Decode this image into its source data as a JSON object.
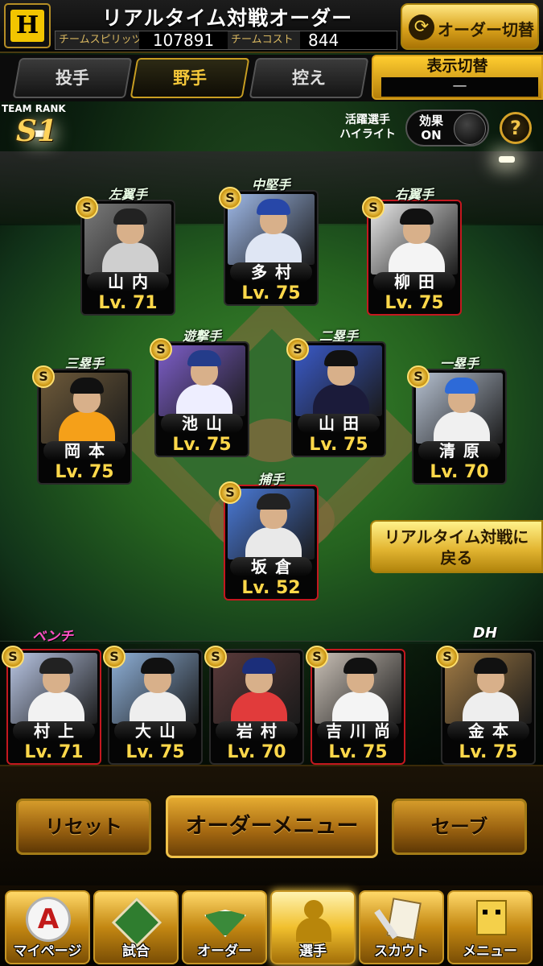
{
  "header": {
    "team_logo_text": "H",
    "title": "リアルタイム対戦オーダー",
    "team_spirits_label": "チームスピリッツ",
    "team_spirits_value": "107891",
    "team_cost_label": "チームコスト",
    "team_cost_value": "844",
    "switch_order_label": "オーダー切替"
  },
  "tabs": [
    {
      "label": "投手",
      "active": false
    },
    {
      "label": "野手",
      "active": true
    },
    {
      "label": "控え",
      "active": false
    }
  ],
  "display_toggle": {
    "label": "表示切替",
    "value": "—"
  },
  "team_rank": {
    "label": "TEAM RANK",
    "value": "S1"
  },
  "highlight": {
    "label_line1": "活躍選手",
    "label_line2": "ハイライト",
    "effect_label_1": "効果",
    "effect_label_2": "ON"
  },
  "help_label": "?",
  "positions": [
    {
      "id": "lf",
      "position": "左翼手",
      "name": "山内",
      "level": "Lv. 71",
      "badge": "S",
      "photo": "#7a7a7a",
      "cap": "#222",
      "body": "#cfcfcf",
      "border": "default"
    },
    {
      "id": "cf",
      "position": "中堅手",
      "name": "多村",
      "level": "Lv. 75",
      "badge": "S",
      "photo": "#9fb9e8",
      "cap": "#2747a8",
      "body": "#dfe6f4",
      "border": "default"
    },
    {
      "id": "rf",
      "position": "右翼手",
      "name": "柳田",
      "level": "Lv. 75",
      "badge": "S",
      "photo": "#e8e8e8",
      "cap": "#111",
      "body": "#f4f4f4",
      "border": "red"
    },
    {
      "id": "ss",
      "position": "遊撃手",
      "name": "池山",
      "level": "Lv. 75",
      "badge": "S",
      "photo": "#7d5ec9",
      "cap": "#243c8a",
      "body": "#eeeeff",
      "border": "default"
    },
    {
      "id": "2b",
      "position": "二塁手",
      "name": "山田",
      "level": "Lv. 75",
      "badge": "S",
      "photo": "#3a5ac8",
      "cap": "#111",
      "body": "#1b1b3a",
      "border": "default"
    },
    {
      "id": "3b",
      "position": "三塁手",
      "name": "岡本",
      "level": "Lv. 75",
      "badge": "S",
      "photo": "#6e5a3a",
      "cap": "#111",
      "body": "#f5a019",
      "border": "default"
    },
    {
      "id": "1b",
      "position": "一塁手",
      "name": "清原",
      "level": "Lv. 70",
      "badge": "S",
      "photo": "#b5c0d0",
      "cap": "#2d6ad8",
      "body": "#f0f0f0",
      "border": "default"
    },
    {
      "id": "c",
      "position": "捕手",
      "name": "坂倉",
      "level": "Lv. 52",
      "badge": "S",
      "photo": "#4a7ad8",
      "cap": "#222",
      "body": "#e9e9e9",
      "border": "red"
    }
  ],
  "bench": {
    "label": "ベンチ",
    "dh_label": "DH",
    "players": [
      {
        "name": "村上",
        "level": "Lv. 71",
        "badge": "S",
        "photo": "#b9c6e4",
        "cap": "#222",
        "body": "#f2f2f2",
        "border": "red"
      },
      {
        "name": "大山",
        "level": "Lv. 75",
        "badge": "S",
        "photo": "#8eb0d8",
        "cap": "#111",
        "body": "#eeeeee",
        "border": "default"
      },
      {
        "name": "岩村",
        "level": "Lv. 70",
        "badge": "S",
        "photo": "#5a3a3a",
        "cap": "#1b2e7a",
        "body": "#e13b3b",
        "border": "default"
      },
      {
        "name": "吉川尚",
        "level": "Lv. 75",
        "badge": "S",
        "photo": "#c9c0b6",
        "cap": "#111",
        "body": "#f4f4f4",
        "border": "red"
      },
      {
        "name": "金本",
        "level": "Lv. 75",
        "badge": "S",
        "photo": "#a07a44",
        "cap": "#111",
        "body": "#eee",
        "border": "default"
      }
    ]
  },
  "return_button": {
    "line1": "リアルタイム対戦に",
    "line2": "戻る"
  },
  "actions": {
    "reset": "リセット",
    "order_menu": "オーダーメニュー",
    "save": "セーブ"
  },
  "footer_nav": [
    {
      "label": "マイページ",
      "icon": "a-icon",
      "active": false
    },
    {
      "label": "試合",
      "icon": "baseball-field-icon",
      "active": false
    },
    {
      "label": "オーダー",
      "icon": "order-field-icon",
      "active": false
    },
    {
      "label": "選手",
      "icon": "player-icon",
      "active": true
    },
    {
      "label": "スカウト",
      "icon": "scout-icon",
      "active": false
    },
    {
      "label": "メニュー",
      "icon": "menu-character-icon",
      "active": false
    }
  ]
}
